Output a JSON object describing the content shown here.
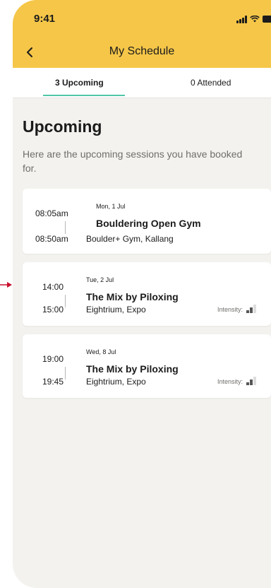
{
  "status": {
    "time": "9:41"
  },
  "nav": {
    "title": "My Schedule",
    "back_icon": "chevron-left-icon"
  },
  "tabs": [
    {
      "label": "3 Upcoming",
      "active": true
    },
    {
      "label": "0 Attended",
      "active": false
    }
  ],
  "section": {
    "title": "Upcoming",
    "subtitle": "Here are the upcoming sessions you have booked for."
  },
  "sessions": [
    {
      "start": "08:05am",
      "end": "08:50am",
      "date": "Mon, 1 Jul",
      "title": "Bouldering Open Gym",
      "venue": "Boulder+ Gym, Kallang",
      "intensity_label": "",
      "intensity_level": null
    },
    {
      "start": "14:00",
      "end": "15:00",
      "date": "Tue, 2 Jul",
      "title": "The Mix by Piloxing",
      "venue": "Eightrium, Expo",
      "intensity_label": "Intensity:",
      "intensity_level": 2
    },
    {
      "start": "19:00",
      "end": "19:45",
      "date": "Wed, 8 Jul",
      "title": "The Mix by Piloxing",
      "venue": "Eightrium, Expo",
      "intensity_label": "Intensity:",
      "intensity_level": 2
    }
  ],
  "colors": {
    "header": "#f5c648",
    "tab_accent": "#4fc6a6",
    "background": "#f3f2ef",
    "pointer": "#c8102e"
  }
}
